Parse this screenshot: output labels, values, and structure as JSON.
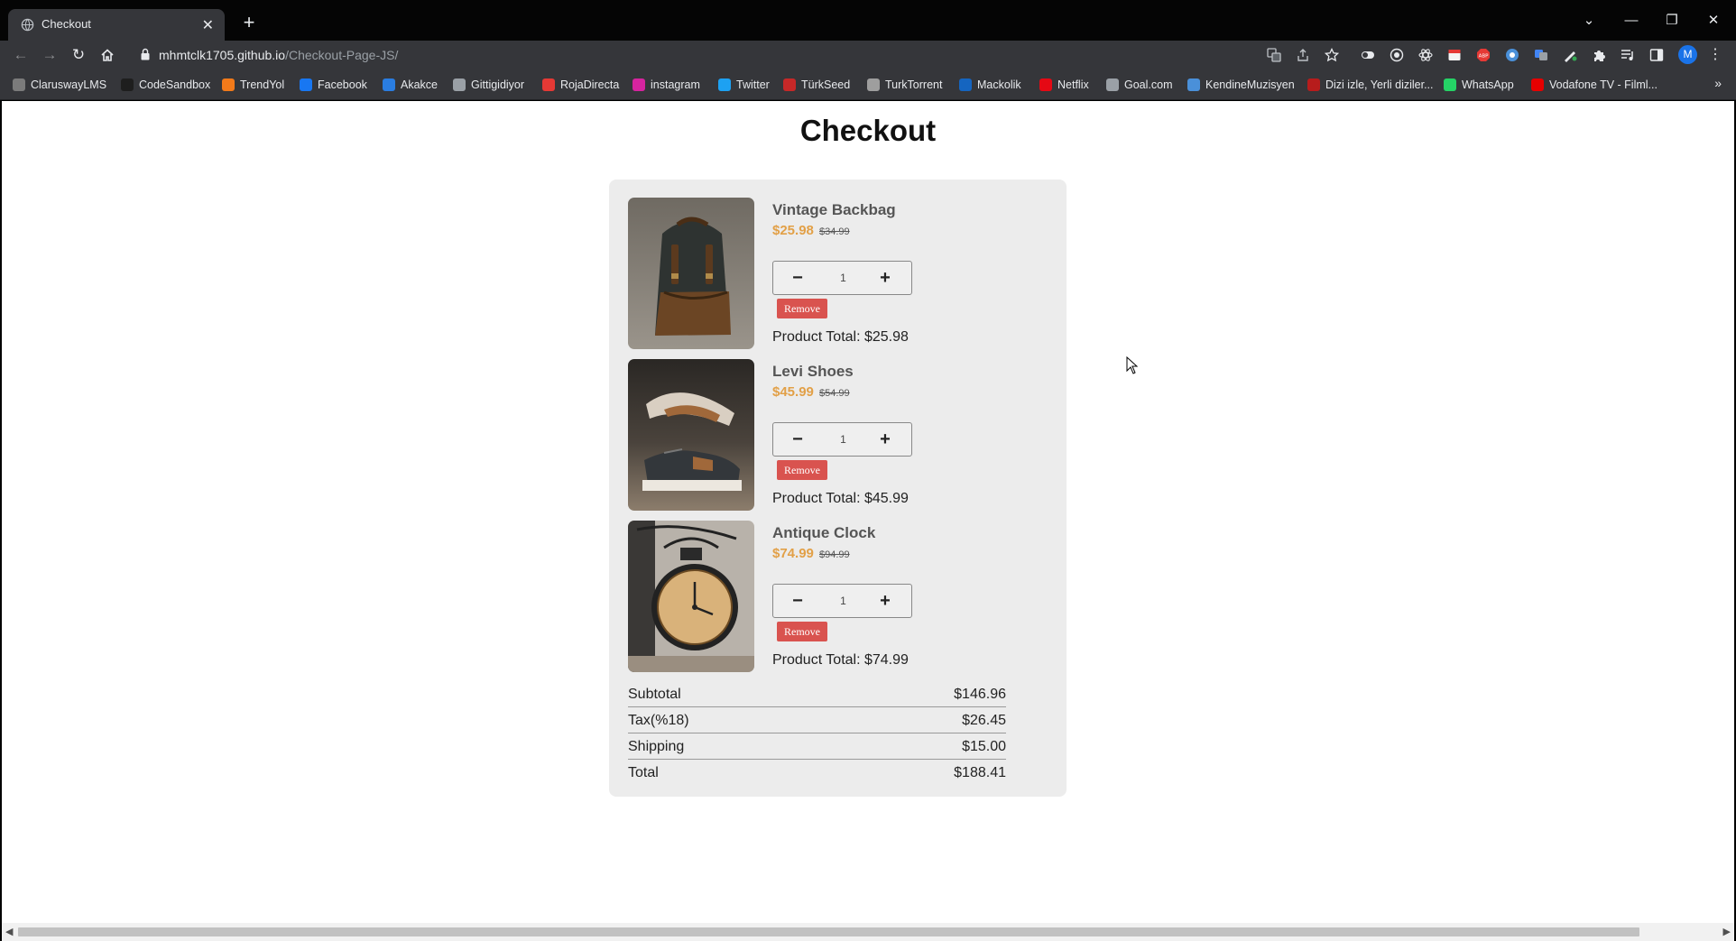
{
  "browser": {
    "tab_title": "Checkout",
    "url_host": "mhmtclk1705.github.io",
    "url_path": "/Checkout-Page-JS/",
    "profile_initial": "M",
    "bookmarks": [
      {
        "label": "ClaruswayLMS",
        "color": "#7b7b7b"
      },
      {
        "label": "CodeSandbox",
        "color": "#1e1e1e"
      },
      {
        "label": "TrendYol",
        "color": "#f27a1a"
      },
      {
        "label": "Facebook",
        "color": "#1877f2"
      },
      {
        "label": "Akakce",
        "color": "#2a7de1"
      },
      {
        "label": "Gittigidiyor",
        "color": "#9aa0a6"
      },
      {
        "label": "RojaDirecta",
        "color": "#e53935"
      },
      {
        "label": "instagram",
        "color": "#d6249f"
      },
      {
        "label": "Twitter",
        "color": "#1da1f2"
      },
      {
        "label": "TürkSeed",
        "color": "#c62828"
      },
      {
        "label": "TurkTorrent",
        "color": "#9e9e9e"
      },
      {
        "label": "Mackolik",
        "color": "#1565c0"
      },
      {
        "label": "Netflix",
        "color": "#e50914"
      },
      {
        "label": "Goal.com",
        "color": "#9aa0a6"
      },
      {
        "label": "KendineMuzisyen",
        "color": "#4a90d9"
      },
      {
        "label": "Dizi izle, Yerli diziler...",
        "color": "#b71c1c"
      },
      {
        "label": "WhatsApp",
        "color": "#25d366"
      },
      {
        "label": "Vodafone TV - Filml...",
        "color": "#e60000"
      }
    ]
  },
  "page": {
    "title": "Checkout",
    "products": [
      {
        "name": "Vintage Backbag",
        "price": "$25.98",
        "old_price": "$34.99",
        "quantity": "1",
        "remove_label": "Remove",
        "total_label": "Product Total: $25.98"
      },
      {
        "name": "Levi Shoes",
        "price": "$45.99",
        "old_price": "$54.99",
        "quantity": "1",
        "remove_label": "Remove",
        "total_label": "Product Total: $45.99"
      },
      {
        "name": "Antique Clock",
        "price": "$74.99",
        "old_price": "$94.99",
        "quantity": "1",
        "remove_label": "Remove",
        "total_label": "Product Total: $74.99"
      }
    ],
    "summary": {
      "subtotal_label": "Subtotal",
      "subtotal": "$146.96",
      "tax_label": "Tax(%18)",
      "tax": "$26.45",
      "shipping_label": "Shipping",
      "shipping": "$15.00",
      "total_label": "Total",
      "total": "$188.41"
    }
  },
  "colors": {
    "chrome_dark": "#35363a",
    "price_accent": "#e2a047",
    "remove_button": "#d9534f",
    "card_background": "#ececec"
  }
}
